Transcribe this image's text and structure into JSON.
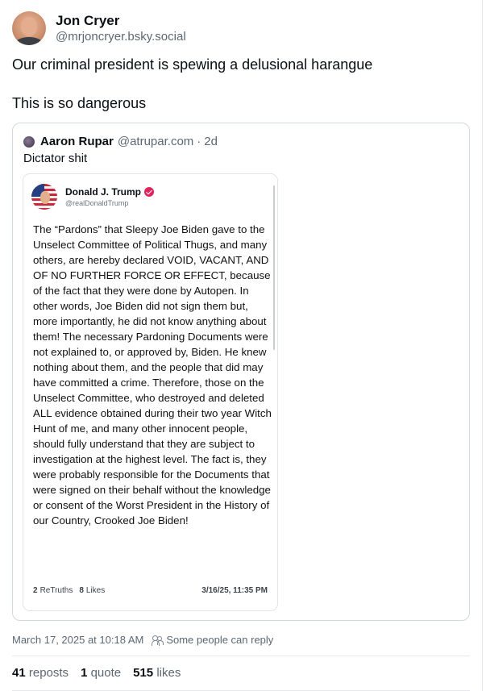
{
  "author": {
    "display_name": "Jon Cryer",
    "handle": "@mrjoncryer.bsky.social"
  },
  "post": {
    "paragraphs": [
      "Our criminal president is spewing a delusional harangue",
      "This is so dangerous"
    ]
  },
  "quote": {
    "author_name": "Aaron Rupar",
    "author_handle": "@atrupar.com",
    "separator": "·",
    "time": "2d",
    "text": "Dictator shit",
    "embed": {
      "author_name": "Donald J. Trump",
      "author_handle": "@realDonaldTrump",
      "body": "The “Pardons” that Sleepy Joe Biden gave to the Unselect Committee of Political Thugs, and many others, are hereby declared VOID, VACANT, AND OF NO FURTHER FORCE OR EFFECT, because of the fact that they were done by Autopen. In other words, Joe Biden did not sign them but, more importantly, he did not know anything about them! The necessary Pardoning Documents were not explained to, or approved by, Biden. He knew nothing about them, and the people that did may have committed a crime. Therefore, those on the Unselect Committee, who destroyed and deleted ALL evidence obtained during their two year Witch Hunt of me, and many other innocent people, should fully understand that they are subject to investigation at the highest level. The fact is, they were probably responsible for the Documents that were signed on their behalf without the knowledge or consent of the Worst President in the History of our Country, Crooked Joe Biden!",
      "retruths_count": "2",
      "retruths_label": "ReTruths",
      "likes_count": "8",
      "likes_label": "Likes",
      "date": "3/16/25, 11:35 PM"
    }
  },
  "meta": {
    "timestamp": "March 17, 2025 at 10:18 AM",
    "reply_setting": "Some people can reply"
  },
  "stats": {
    "reposts_count": "41",
    "reposts_label": "reposts",
    "quotes_count": "1",
    "quotes_label": "quote",
    "likes_count": "515",
    "likes_label": "likes"
  }
}
